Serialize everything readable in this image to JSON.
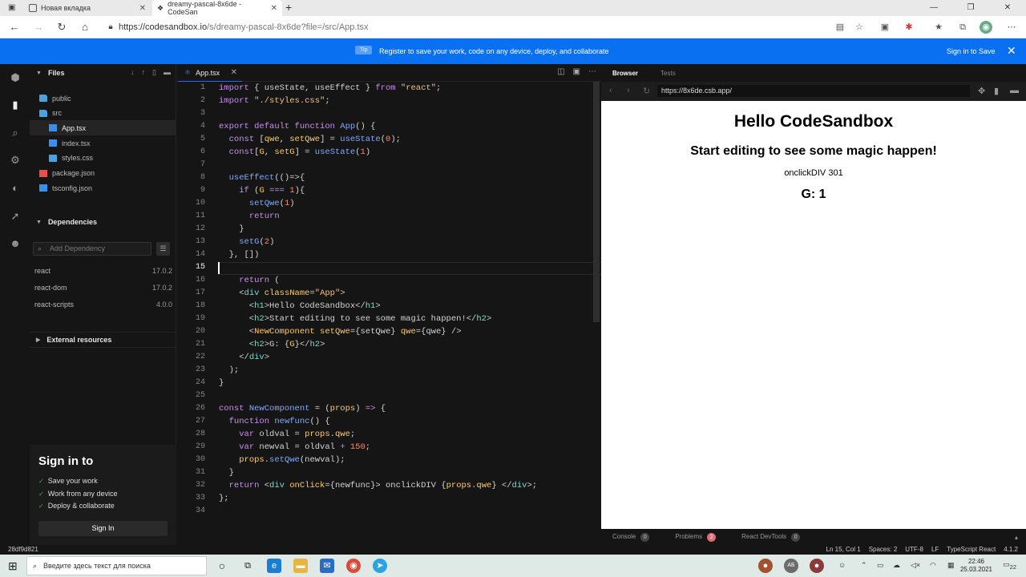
{
  "browser": {
    "tabs": [
      {
        "title": "Новая вкладка"
      },
      {
        "title": "dreamy-pascal-8x6de - CodeSan"
      }
    ],
    "url_host": "https://codesandbox.io",
    "url_path": "/s/dreamy-pascal-8x6de?file=/src/App.tsx",
    "window_controls": [
      "—",
      "❐",
      "✕"
    ]
  },
  "banner": {
    "tip": "Tip",
    "text": "Register to save your work, code on any device, deploy, and collaborate",
    "action": "Sign in to Save"
  },
  "sidebar": {
    "files_title": "Files",
    "files": [
      {
        "name": "public",
        "kind": "folder",
        "indent": 0
      },
      {
        "name": "src",
        "kind": "folder",
        "indent": 0
      },
      {
        "name": "App.tsx",
        "kind": "ts",
        "indent": 1,
        "selected": true
      },
      {
        "name": "index.tsx",
        "kind": "ts",
        "indent": 1
      },
      {
        "name": "styles.css",
        "kind": "css",
        "indent": 1
      },
      {
        "name": "package.json",
        "kind": "json",
        "indent": 0
      },
      {
        "name": "tsconfig.json",
        "kind": "ts",
        "indent": 0
      }
    ],
    "dependencies_title": "Dependencies",
    "dependency_placeholder": "Add Dependency",
    "dependencies": [
      {
        "name": "react",
        "version": "17.0.2"
      },
      {
        "name": "react-dom",
        "version": "17.0.2"
      },
      {
        "name": "react-scripts",
        "version": "4.0.0"
      }
    ],
    "external_title": "External resources",
    "signin": {
      "title": "Sign in to",
      "items": [
        "Save your work",
        "Work from any device",
        "Deploy & collaborate"
      ],
      "button": "Sign In"
    }
  },
  "editor": {
    "tab": "App.tsx",
    "current_line": 15
  },
  "preview": {
    "tabs": [
      "Browser",
      "Tests"
    ],
    "url": "https://8x6de.csb.app/",
    "h1": "Hello CodeSandbox",
    "h2": "Start editing to see some magic happen!",
    "div": "onclickDIV 301",
    "g": "G: 1",
    "bottom": [
      {
        "label": "Console",
        "count": "0"
      },
      {
        "label": "Problems",
        "count": "2"
      },
      {
        "label": "React DevTools",
        "count": "0"
      }
    ]
  },
  "status": {
    "commit": "28df9d821",
    "right": [
      "Ln 15, Col 1",
      "Spaces: 2",
      "UTF-8",
      "LF",
      "TypeScript React",
      "4.1.2"
    ]
  },
  "taskbar": {
    "search": "Введите здесь текст для поиска",
    "time": "22:46",
    "date": "25.03.2021",
    "user": "АБ",
    "notifications": "22"
  }
}
